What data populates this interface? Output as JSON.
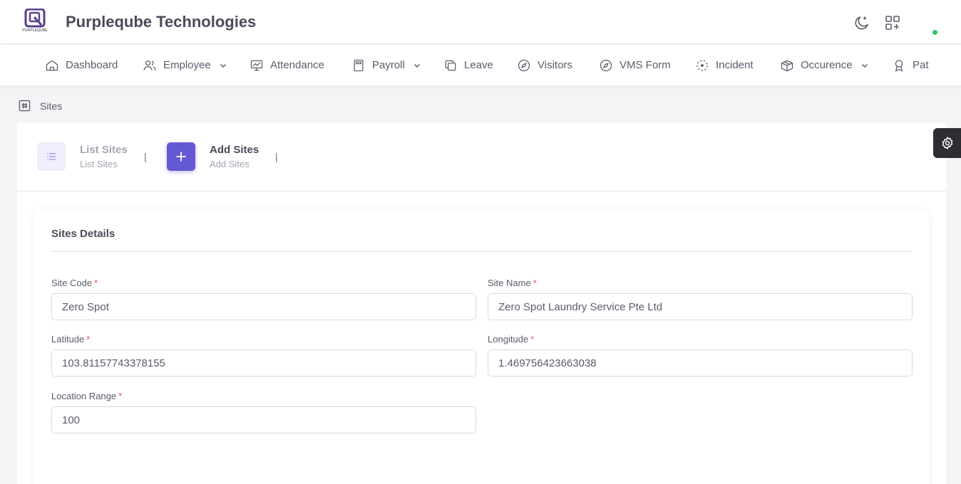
{
  "header": {
    "logo_caption": "PURPLEQUBE",
    "company_name": "Purpleqube Technologies",
    "icons": [
      "moon-icon",
      "apps-add-icon"
    ],
    "status_color": "#28c76f"
  },
  "nav": {
    "items": [
      {
        "label": "Dashboard",
        "icon": "home-icon",
        "dropdown": false
      },
      {
        "label": "Employee",
        "icon": "users-icon",
        "dropdown": true
      },
      {
        "label": "Attendance",
        "icon": "presentation-icon",
        "dropdown": false
      },
      {
        "label": "Payroll",
        "icon": "calculator-icon",
        "dropdown": true
      },
      {
        "label": "Leave",
        "icon": "copy-icon",
        "dropdown": false
      },
      {
        "label": "Visitors",
        "icon": "compass-icon",
        "dropdown": false
      },
      {
        "label": "VMS Form",
        "icon": "compass-icon",
        "dropdown": false
      },
      {
        "label": "Incident",
        "icon": "focus-icon",
        "dropdown": false
      },
      {
        "label": "Occurence",
        "icon": "box-icon",
        "dropdown": true
      },
      {
        "label": "Pat",
        "icon": "award-icon",
        "dropdown": false
      }
    ]
  },
  "breadcrumb": {
    "icon": "hash-icon",
    "label": "Sites"
  },
  "steps": [
    {
      "title": "List Sites",
      "subtitle": "List Sites",
      "icon": "list-icon",
      "active": false
    },
    {
      "title": "Add Sites",
      "subtitle": "Add Sites",
      "icon": "plus-icon",
      "active": true
    }
  ],
  "step_divider": "|",
  "form": {
    "title": "Sites Details",
    "fields": {
      "site_code": {
        "label": "Site Code",
        "required": "*",
        "value": "Zero Spot"
      },
      "site_name": {
        "label": "Site Name",
        "required": "*",
        "value": "Zero Spot Laundry Service Pte Ltd"
      },
      "latitude": {
        "label": "Latitude",
        "required": "*",
        "value": "103.81157743378155"
      },
      "longitude": {
        "label": "Longitude",
        "required": "*",
        "value": "1.469756423663038"
      },
      "location_range": {
        "label": "Location Range",
        "required": "*",
        "value": "100"
      }
    }
  },
  "colors": {
    "accent": "#6558d3",
    "accent_light": "#efeefb",
    "required": "#ea5455",
    "settings_bg": "#2d2d33"
  }
}
